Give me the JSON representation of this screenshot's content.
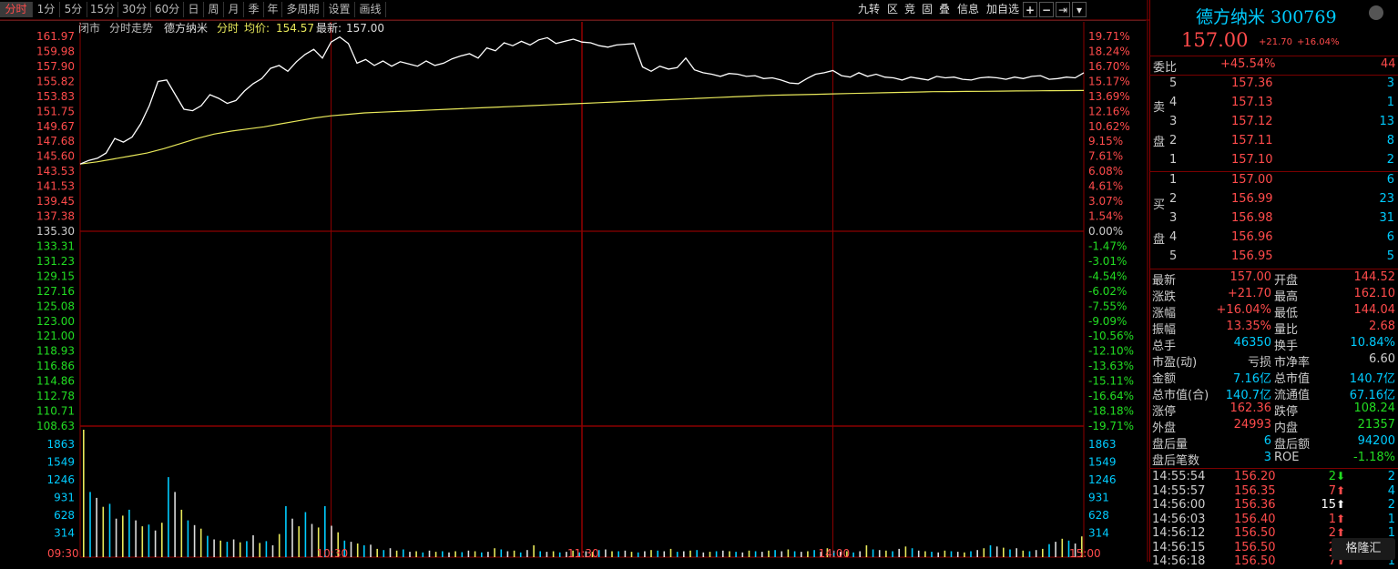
{
  "toolbar": {
    "periods": [
      "分时",
      "1分",
      "5分",
      "15分",
      "30分",
      "60分",
      "日",
      "周",
      "月",
      "季",
      "年",
      "多周期",
      "设置",
      "画线"
    ],
    "active_period": "分时",
    "tools": [
      "九转",
      "区",
      "竞",
      "固",
      "叠",
      "信息",
      "加自选",
      "+",
      "−",
      "⇥",
      "▾"
    ]
  },
  "chart_header": {
    "status": "闭市",
    "type": "分时走势",
    "name": "德方纳米",
    "mode": "分时",
    "avg_label": "均价:",
    "avg_value": "154.57",
    "latest_label": "最新:",
    "latest_value": "157.00"
  },
  "chart_data": {
    "type": "line",
    "prev_close": 135.3,
    "ylim": [
      108.63,
      161.97
    ],
    "price_ticks": [
      "161.97",
      "159.98",
      "157.90",
      "155.82",
      "153.83",
      "151.75",
      "149.67",
      "147.68",
      "145.60",
      "143.53",
      "141.53",
      "139.45",
      "137.38",
      "135.30",
      "133.31",
      "131.23",
      "129.15",
      "127.16",
      "125.08",
      "123.00",
      "121.00",
      "118.93",
      "116.86",
      "114.86",
      "112.78",
      "110.71",
      "108.63"
    ],
    "pct_ticks": [
      "19.71%",
      "18.24%",
      "16.70%",
      "15.17%",
      "13.69%",
      "12.16%",
      "10.62%",
      "9.15%",
      "7.61%",
      "6.08%",
      "4.61%",
      "3.07%",
      "1.54%",
      "0.00%",
      "-1.47%",
      "-3.01%",
      "-4.54%",
      "-6.02%",
      "-7.55%",
      "-9.09%",
      "-10.56%",
      "-12.10%",
      "-13.63%",
      "-15.11%",
      "-16.64%",
      "-18.18%",
      "-19.71%"
    ],
    "time_labels": [
      "09:30",
      "10:30",
      "11:30",
      "14:00",
      "15:00"
    ],
    "volume_ticks": [
      "1863",
      "1549",
      "1246",
      "931",
      "628",
      "314"
    ],
    "volume_max": 2150,
    "series": [
      {
        "color": "#ffffff",
        "values": [
          144.5,
          145.0,
          145.3,
          146.0,
          148.0,
          147.5,
          148.2,
          150.0,
          152.5,
          155.8,
          156.0,
          154.0,
          152.0,
          151.8,
          152.5,
          154.0,
          153.5,
          152.8,
          153.2,
          154.5,
          155.5,
          156.2,
          157.6,
          158.0,
          157.2,
          158.5,
          159.5,
          160.2,
          159.0,
          161.2,
          161.9,
          161.0,
          158.3,
          158.8,
          158.0,
          158.6,
          157.9,
          158.5,
          158.2,
          157.9,
          158.6,
          158.0,
          158.3,
          158.9,
          159.3,
          159.6,
          159.0,
          160.4,
          160.0,
          161.1,
          160.7,
          161.3,
          160.8,
          161.5,
          161.8,
          161.0,
          161.3,
          161.6,
          161.2,
          161.1,
          160.7,
          160.5,
          160.8,
          160.9,
          161.0,
          157.8,
          157.2,
          157.9,
          157.5,
          157.7,
          159.0,
          157.4,
          157.0,
          156.8,
          156.5,
          156.9,
          156.8,
          156.5,
          156.6,
          156.2,
          156.3,
          156.0,
          155.6,
          155.5,
          156.2,
          156.8,
          157.0,
          157.3,
          156.6,
          156.4,
          157.0,
          156.5,
          156.8,
          156.4,
          156.3,
          156.0,
          156.4,
          156.2,
          156.0,
          156.5,
          156.3,
          156.4,
          156.1,
          156.0,
          156.3,
          156.4,
          156.3,
          156.1,
          156.4,
          156.2,
          156.5,
          156.6,
          156.1,
          156.2,
          156.4,
          156.3,
          157.0
        ]
      },
      {
        "color": "#e8e85a",
        "values": [
          144.5,
          144.8,
          145.2,
          145.6,
          146.0,
          146.6,
          147.3,
          148.0,
          148.6,
          149.0,
          149.3,
          149.6,
          150.0,
          150.4,
          150.8,
          151.1,
          151.3,
          151.5,
          151.6,
          151.7,
          151.8,
          151.9,
          152.0,
          152.1,
          152.2,
          152.3,
          152.4,
          152.5,
          152.6,
          152.7,
          152.8,
          152.9,
          153.0,
          153.1,
          153.2,
          153.3,
          153.4,
          153.5,
          153.6,
          153.7,
          153.8,
          153.9,
          153.95,
          154.0,
          154.05,
          154.1,
          154.15,
          154.2,
          154.25,
          154.3,
          154.35,
          154.4,
          154.42,
          154.44,
          154.46,
          154.48,
          154.5,
          154.52,
          154.54,
          154.56,
          154.57
        ]
      }
    ],
    "volume": [
      2150,
      1100,
      1000,
      850,
      900,
      650,
      700,
      800,
      620,
      520,
      550,
      450,
      580,
      1350,
      1100,
      800,
      620,
      540,
      480,
      360,
      300,
      280,
      260,
      300,
      250,
      270,
      370,
      240,
      270,
      200,
      390,
      860,
      650,
      520,
      760,
      560,
      500,
      860,
      530,
      420,
      280,
      260,
      230,
      200,
      210,
      140,
      120,
      150,
      110,
      130,
      90,
      100,
      80,
      110,
      90,
      100,
      80,
      100,
      85,
      110,
      100,
      80,
      90,
      150,
      130,
      100,
      110,
      80,
      120,
      200,
      100,
      90,
      100,
      80,
      90,
      110,
      80,
      100,
      90,
      120,
      130,
      100,
      100,
      110,
      90,
      80,
      100,
      120,
      110,
      100,
      140,
      90,
      100,
      110,
      120,
      80,
      90,
      100,
      110,
      100,
      90,
      80,
      110,
      100,
      90,
      110,
      120,
      100,
      130,
      100,
      90,
      100,
      120,
      90,
      150,
      110,
      90,
      100,
      80,
      100,
      200,
      130,
      120,
      110,
      100,
      140,
      180,
      150,
      110,
      100,
      90,
      80,
      110,
      100,
      90,
      80,
      100,
      120,
      150,
      200,
      180,
      160,
      130,
      150,
      110,
      100,
      120,
      140,
      220,
      260,
      310,
      280,
      230,
      350
    ]
  },
  "quote": {
    "title": "德方纳米 300769",
    "price": "157.00",
    "change": "+21.70",
    "change_pct": "+16.04%",
    "weibi_label": "委比",
    "weibi_pct": "+45.54%",
    "weibi_diff": "44",
    "sell_label": [
      "卖",
      "盘"
    ],
    "buy_label": [
      "买",
      "盘"
    ],
    "sells": [
      {
        "lvl": "5",
        "price": "157.36",
        "vol": "3"
      },
      {
        "lvl": "4",
        "price": "157.13",
        "vol": "1"
      },
      {
        "lvl": "3",
        "price": "157.12",
        "vol": "13"
      },
      {
        "lvl": "2",
        "price": "157.11",
        "vol": "8"
      },
      {
        "lvl": "1",
        "price": "157.10",
        "vol": "2"
      }
    ],
    "buys": [
      {
        "lvl": "1",
        "price": "157.00",
        "vol": "6"
      },
      {
        "lvl": "2",
        "price": "156.99",
        "vol": "23"
      },
      {
        "lvl": "3",
        "price": "156.98",
        "vol": "31"
      },
      {
        "lvl": "4",
        "price": "156.96",
        "vol": "6"
      },
      {
        "lvl": "5",
        "price": "156.95",
        "vol": "5"
      }
    ],
    "stats": [
      {
        "l1": "最新",
        "v1": "157.00",
        "c1": "#ff4b4b",
        "l2": "开盘",
        "v2": "144.52",
        "c2": "#ff4b4b"
      },
      {
        "l1": "涨跌",
        "v1": "+21.70",
        "c1": "#ff4b4b",
        "l2": "最高",
        "v2": "162.10",
        "c2": "#ff4b4b"
      },
      {
        "l1": "涨幅",
        "v1": "+16.04%",
        "c1": "#ff4b4b",
        "l2": "最低",
        "v2": "144.04",
        "c2": "#ff4b4b"
      },
      {
        "l1": "振幅",
        "v1": "13.35%",
        "c1": "#ff4b4b",
        "l2": "量比",
        "v2": "2.68",
        "c2": "#ff4b4b"
      },
      {
        "l1": "总手",
        "v1": "46350",
        "c1": "#00ccff",
        "l2": "换手",
        "v2": "10.84%",
        "c2": "#00ccff"
      },
      {
        "l1": "市盈(动)",
        "v1": "亏损",
        "c1": "#cccccc",
        "l2": "市净率",
        "v2": "6.60",
        "c2": "#cccccc"
      },
      {
        "l1": "金额",
        "v1": "7.16亿",
        "c1": "#00ccff",
        "l2": "总市值",
        "v2": "140.7亿",
        "c2": "#00ccff"
      },
      {
        "l1": "总市值(合)",
        "v1": "140.7亿",
        "c1": "#00ccff",
        "l2": "流通值",
        "v2": "67.16亿",
        "c2": "#00ccff"
      },
      {
        "l1": "涨停",
        "v1": "162.36",
        "c1": "#ff4b4b",
        "l2": "跌停",
        "v2": "108.24",
        "c2": "#22dd22"
      },
      {
        "l1": "外盘",
        "v1": "24993",
        "c1": "#ff4b4b",
        "l2": "内盘",
        "v2": "21357",
        "c2": "#22dd22"
      },
      {
        "l1": "盘后量",
        "v1": "6",
        "c1": "#00ccff",
        "l2": "盘后额",
        "v2": "94200",
        "c2": "#00ccff"
      },
      {
        "l1": "盘后笔数",
        "v1": "3",
        "c1": "#00ccff",
        "l2": "ROE",
        "v2": "-1.18%",
        "c2": "#22dd22"
      }
    ],
    "ticks": [
      {
        "time": "14:55:54",
        "price": "156.20",
        "vol": "2",
        "dir": "down",
        "n": "2"
      },
      {
        "time": "14:55:57",
        "price": "156.35",
        "vol": "7",
        "dir": "up",
        "n": "4"
      },
      {
        "time": "14:56:00",
        "price": "156.36",
        "vol": "15",
        "dir": "upw",
        "n": "2"
      },
      {
        "time": "14:56:03",
        "price": "156.40",
        "vol": "1",
        "dir": "up",
        "n": "1"
      },
      {
        "time": "14:56:12",
        "price": "156.50",
        "vol": "2",
        "dir": "up",
        "n": "1"
      },
      {
        "time": "14:56:15",
        "price": "156.50",
        "vol": "2",
        "dir": "up",
        "n": "1"
      },
      {
        "time": "14:56:18",
        "price": "156.50",
        "vol": "7",
        "dir": "up",
        "n": "1"
      }
    ]
  },
  "watermark": "格隆汇",
  "colors": {
    "up": "#ff4b4b",
    "down": "#22dd22",
    "grid": "#8b0000",
    "cyan": "#00ccff",
    "yellow": "#e8e85a"
  }
}
